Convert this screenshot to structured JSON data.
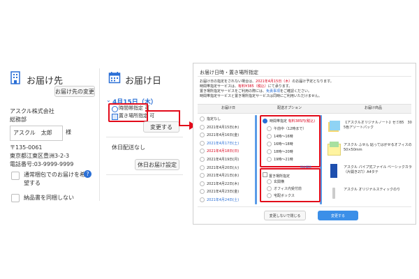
{
  "left": {
    "header_title": "お届け先",
    "change_button": "お届け先の変更",
    "company": "アスクル株式会社",
    "department": "総務部",
    "name_value": "アスクル　太郎",
    "honorific": "様",
    "postal": "〒135-0061",
    "address": "東京都江東区豊洲3-2-3",
    "phone": "電話番号:03-9999-9999",
    "checkbox_packing_line1": "通常梱包でのお届けを希",
    "checkbox_packing_line2": "望する",
    "help_icon_glyph": "?",
    "checkbox_receipt": "納品書を同梱しない"
  },
  "middle": {
    "header_title": "お届け日",
    "selected_date": "4月15日（木）",
    "time_option": "時間帯指定 可",
    "place_option": "置き場所指定 可",
    "change_button": "変更する",
    "holiday_text": "休日配送なし",
    "holiday_button": "休日お届け設定"
  },
  "dialog": {
    "title": "お届け日時・置き場所指定",
    "notice_line1_pre": "お届け日の指定をされない場合は、",
    "notice_line1_em": "2021年4月15日（木）",
    "notice_line1_post": "のお届け予定となります。",
    "notice_line2_pre": "時間帯指定サービスは、",
    "notice_line2_em": "有料¥385（税込）",
    "notice_line2_post": "にて承ります。",
    "notice_line3_pre": "置き場所指定サービスをご利用の際には、",
    "notice_line3_link": "免責事項",
    "notice_line3_post": "をご確認ください。",
    "notice_line4": "時間帯指定サービスと置き場所指定サービスは同時にご利用いただけません。",
    "col_headers": [
      "お届け日",
      "配送オプション",
      "お届け商品"
    ],
    "dates": [
      {
        "label": "指定なし",
        "color": "#333333"
      },
      {
        "label": "2021年4月15日(木)",
        "color": "#333333"
      },
      {
        "label": "2021年4月16日(金)",
        "color": "#333333"
      },
      {
        "label": "2021年4月17日(土)",
        "color": "#2a6fd6"
      },
      {
        "label": "2021年4月18日(日)",
        "color": "#d9001b"
      },
      {
        "label": "2021年4月19日(月)",
        "color": "#333333"
      },
      {
        "label": "2021年4月20日(火)",
        "color": "#333333"
      },
      {
        "label": "2021年4月21日(水)",
        "color": "#333333"
      },
      {
        "label": "2021年4月22日(木)",
        "color": "#333333"
      },
      {
        "label": "2021年4月23日(金)",
        "color": "#333333"
      },
      {
        "label": "2021年4月24日(土)",
        "color": "#2a6fd6"
      }
    ],
    "time_header": "時間帯指定",
    "time_fee": "有料385円(税込)",
    "time_slots": [
      "午前中（12時まで）",
      "14時〜16時",
      "16時〜18時",
      "18時〜20時",
      "19時〜21時"
    ],
    "time_link": "指定解除",
    "place_header": "置き場所指定",
    "place_options": [
      "玄関横",
      "オフィス内受付前",
      "宅配ボックス"
    ],
    "products": [
      {
        "name": "【アスクルオリジナルノート】ゼミB5　30枚\n5色アソートパック"
      },
      {
        "name": "アスクル ふせん 貼ってはがせるオフィスのふせん\n50×50mm"
      },
      {
        "name": "アスクル パイプ式ファイル ベーシックカラー\n（片開き2穴）A4タテ"
      },
      {
        "name": "アスクル オリジナルスティックのり"
      }
    ],
    "close_button": "変更しないで閉じる",
    "confirm_button": "変更する"
  },
  "colors": {
    "accent": "#2a6fd6",
    "highlight": "#e20a1a",
    "confirm": "#3b8fe8"
  }
}
